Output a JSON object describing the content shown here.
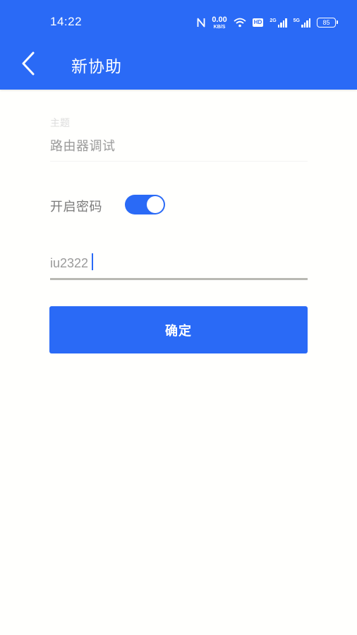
{
  "status_bar": {
    "time": "14:22",
    "net_speed_value": "0.00",
    "net_speed_unit": "KB/S",
    "hd_label": "HD",
    "sim1_label": "2G",
    "sim2_label": "5G",
    "battery_level": "85",
    "icons": [
      "nfc-icon",
      "wifi-icon",
      "hd-icon",
      "signal-icon",
      "battery-icon"
    ]
  },
  "header": {
    "title": "新协助",
    "back_icon": "chevron-left-icon",
    "background_color": "#2a6af6"
  },
  "form": {
    "subject_label": "主题",
    "subject_value": "路由器调试",
    "password_toggle_label": "开启密码",
    "password_toggle_on": true,
    "password_value": "iu2322",
    "confirm_label": "确定"
  },
  "colors": {
    "accent": "#2a6af6",
    "background": "#fffffd"
  }
}
